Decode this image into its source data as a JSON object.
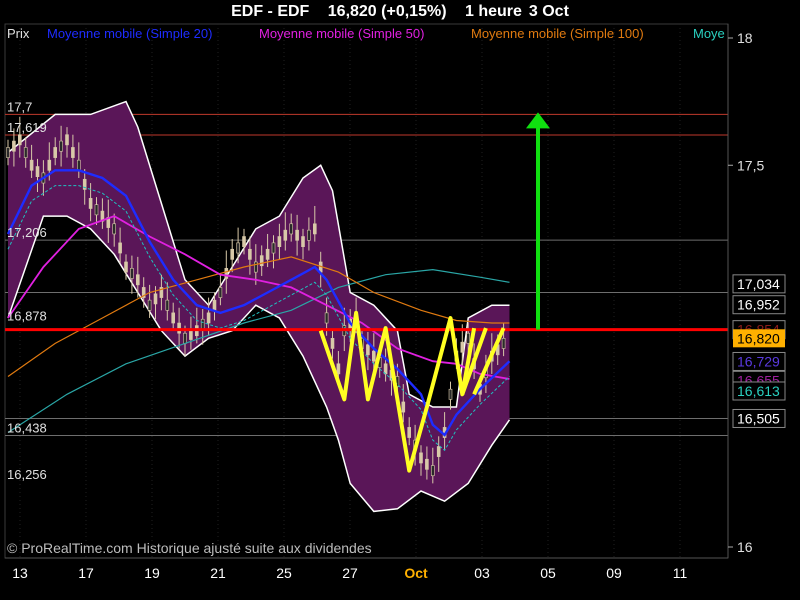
{
  "header": {
    "symbol": "EDF - EDF",
    "price": "16,820 (+0,15%)",
    "period": "1 heure",
    "date": "3 Oct"
  },
  "colors": {
    "background": "#000000",
    "grid": "#6e6e6e",
    "band_fill": "#5a1658",
    "band_line": "#ffffff",
    "sma20": "#1e2cff",
    "sma50": "#e020e0",
    "sma100": "#e07a10",
    "sma200": "#2aa6a6",
    "pattern": "#ffff22",
    "target": "#10e010",
    "resistance": "#ff0000",
    "hline": "#c0392b",
    "price_tag": "#ffb000"
  },
  "chart_data": {
    "type": "line",
    "title": "EDF - EDF",
    "y_axis": {
      "min": 16.0,
      "max": 18.0,
      "ticks": [
        "18",
        "17,5",
        "16"
      ],
      "position": "right"
    },
    "x_axis": {
      "ticks": [
        "13",
        "17",
        "19",
        "21",
        "25",
        "27",
        "Oct",
        "03",
        "05",
        "09",
        "11"
      ],
      "bold_tick": "Oct"
    },
    "legend": [
      "Prix",
      "Moyenne mobile (Simple 20)",
      "Moyenne mobile (Simple 50)",
      "Moyenne mobile (Simple 100)",
      "Moye"
    ],
    "watermark": "© ProRealTime.com Historique ajusté suite aux dividendes",
    "left_levels": [
      {
        "label": "17,7",
        "value": 17.7
      },
      {
        "label": "17,619",
        "value": 17.619
      },
      {
        "label": "17,206",
        "value": 17.206
      },
      {
        "label": "16,878",
        "value": 16.878
      },
      {
        "label": "16,438",
        "value": 16.438
      },
      {
        "label": "16,256",
        "value": 16.256
      }
    ],
    "horizontal_lines": [
      {
        "value": 17.7,
        "style": "red"
      },
      {
        "value": 17.619,
        "style": "red"
      },
      {
        "value": 17.206,
        "style": "gray"
      },
      {
        "value": 17.0,
        "style": "gray"
      },
      {
        "value": 16.505,
        "style": "gray"
      },
      {
        "value": 16.438,
        "style": "gray"
      }
    ],
    "resistance": 16.854,
    "target_arrow": {
      "from": 16.854,
      "to": 17.7,
      "x_index": 90
    },
    "right_tags": [
      {
        "label": "17,034",
        "value": 17.034,
        "color": "#000000",
        "text": "#ffffff"
      },
      {
        "label": "16,952",
        "value": 16.952,
        "color": "#000000",
        "text": "#ffffff"
      },
      {
        "label": "16,854",
        "value": 16.854,
        "color": "#000000",
        "text": "#8a1c1c"
      },
      {
        "label": "16,820",
        "value": 16.82,
        "color": "#ffb000",
        "text": "#000000"
      },
      {
        "label": "16,729",
        "value": 16.729,
        "color": "#000000",
        "text": "#5a3ae0"
      },
      {
        "label": "16,655",
        "value": 16.655,
        "color": "#000000",
        "text": "#a020a0"
      },
      {
        "label": "16,613",
        "value": 16.613,
        "color": "#000000",
        "text": "#2ad0c0"
      },
      {
        "label": "16,505",
        "value": 16.505,
        "color": "#000000",
        "text": "#ffffff"
      }
    ],
    "bollinger_upper": [
      [
        0,
        17.55
      ],
      [
        8,
        17.7
      ],
      [
        14,
        17.7
      ],
      [
        20,
        17.75
      ],
      [
        22,
        17.65
      ],
      [
        26,
        17.35
      ],
      [
        30,
        17.05
      ],
      [
        34,
        16.95
      ],
      [
        38,
        17.1
      ],
      [
        42,
        17.25
      ],
      [
        46,
        17.3
      ],
      [
        50,
        17.45
      ],
      [
        53,
        17.5
      ],
      [
        55,
        17.4
      ],
      [
        58,
        17.0
      ],
      [
        62,
        16.95
      ],
      [
        66,
        16.85
      ],
      [
        68,
        16.6
      ],
      [
        72,
        16.55
      ],
      [
        76,
        16.55
      ],
      [
        78,
        16.9
      ],
      [
        82,
        16.95
      ],
      [
        85,
        16.95
      ]
    ],
    "bollinger_lower": [
      [
        0,
        16.9
      ],
      [
        6,
        17.3
      ],
      [
        10,
        17.3
      ],
      [
        14,
        17.25
      ],
      [
        18,
        17.15
      ],
      [
        22,
        17.0
      ],
      [
        26,
        16.85
      ],
      [
        30,
        16.75
      ],
      [
        34,
        16.82
      ],
      [
        38,
        16.85
      ],
      [
        42,
        16.95
      ],
      [
        46,
        16.9
      ],
      [
        50,
        16.75
      ],
      [
        54,
        16.55
      ],
      [
        56,
        16.42
      ],
      [
        58,
        16.25
      ],
      [
        62,
        16.14
      ],
      [
        66,
        16.15
      ],
      [
        70,
        16.22
      ],
      [
        74,
        16.18
      ],
      [
        78,
        16.25
      ],
      [
        82,
        16.4
      ],
      [
        85,
        16.5
      ]
    ],
    "sma20": [
      [
        0,
        17.23
      ],
      [
        4,
        17.42
      ],
      [
        8,
        17.48
      ],
      [
        12,
        17.48
      ],
      [
        16,
        17.45
      ],
      [
        20,
        17.38
      ],
      [
        24,
        17.2
      ],
      [
        28,
        17.05
      ],
      [
        32,
        16.95
      ],
      [
        36,
        16.92
      ],
      [
        40,
        16.95
      ],
      [
        44,
        17.0
      ],
      [
        48,
        17.05
      ],
      [
        52,
        17.1
      ],
      [
        54,
        17.05
      ],
      [
        58,
        16.88
      ],
      [
        62,
        16.78
      ],
      [
        66,
        16.7
      ],
      [
        70,
        16.6
      ],
      [
        72,
        16.48
      ],
      [
        74,
        16.44
      ],
      [
        76,
        16.52
      ],
      [
        80,
        16.62
      ],
      [
        85,
        16.73
      ]
    ],
    "sma50": [
      [
        0,
        16.9
      ],
      [
        6,
        17.1
      ],
      [
        12,
        17.25
      ],
      [
        18,
        17.3
      ],
      [
        24,
        17.22
      ],
      [
        30,
        17.15
      ],
      [
        36,
        17.07
      ],
      [
        42,
        17.05
      ],
      [
        48,
        17.02
      ],
      [
        54,
        16.95
      ],
      [
        60,
        16.88
      ],
      [
        66,
        16.78
      ],
      [
        72,
        16.73
      ],
      [
        76,
        16.72
      ],
      [
        80,
        16.68
      ],
      [
        85,
        16.66
      ]
    ],
    "sma100": [
      [
        0,
        16.67
      ],
      [
        8,
        16.8
      ],
      [
        16,
        16.9
      ],
      [
        24,
        17.0
      ],
      [
        32,
        17.05
      ],
      [
        40,
        17.1
      ],
      [
        48,
        17.14
      ],
      [
        56,
        17.08
      ],
      [
        62,
        17.0
      ],
      [
        70,
        16.93
      ],
      [
        76,
        16.89
      ],
      [
        82,
        16.88
      ],
      [
        85,
        16.88
      ]
    ],
    "sma200": [
      [
        0,
        16.45
      ],
      [
        10,
        16.6
      ],
      [
        20,
        16.72
      ],
      [
        30,
        16.8
      ],
      [
        40,
        16.88
      ],
      [
        48,
        16.93
      ],
      [
        56,
        17.02
      ],
      [
        64,
        17.07
      ],
      [
        72,
        17.09
      ],
      [
        80,
        17.06
      ],
      [
        85,
        17.04
      ]
    ],
    "price": [
      [
        0,
        17.55
      ],
      [
        2,
        17.6
      ],
      [
        4,
        17.5
      ],
      [
        6,
        17.45
      ],
      [
        8,
        17.55
      ],
      [
        10,
        17.6
      ],
      [
        12,
        17.5
      ],
      [
        14,
        17.35
      ],
      [
        16,
        17.3
      ],
      [
        18,
        17.25
      ],
      [
        20,
        17.1
      ],
      [
        22,
        17.05
      ],
      [
        24,
        16.95
      ],
      [
        26,
        17.0
      ],
      [
        28,
        16.9
      ],
      [
        30,
        16.82
      ],
      [
        32,
        16.85
      ],
      [
        34,
        16.9
      ],
      [
        36,
        17.0
      ],
      [
        38,
        17.15
      ],
      [
        40,
        17.2
      ],
      [
        42,
        17.1
      ],
      [
        44,
        17.15
      ],
      [
        46,
        17.2
      ],
      [
        48,
        17.25
      ],
      [
        50,
        17.2
      ],
      [
        52,
        17.25
      ],
      [
        53,
        17.1
      ],
      [
        54,
        16.9
      ],
      [
        56,
        16.7
      ],
      [
        57,
        16.85
      ],
      [
        59,
        16.9
      ],
      [
        60,
        16.8
      ],
      [
        62,
        16.75
      ],
      [
        64,
        16.7
      ],
      [
        66,
        16.65
      ],
      [
        68,
        16.45
      ],
      [
        70,
        16.35
      ],
      [
        72,
        16.3
      ],
      [
        74,
        16.45
      ],
      [
        76,
        16.75
      ],
      [
        78,
        16.82
      ],
      [
        80,
        16.62
      ],
      [
        82,
        16.75
      ],
      [
        84,
        16.8
      ],
      [
        85,
        16.82
      ]
    ],
    "pattern_lines": [
      [
        [
          53,
          16.85
        ],
        [
          57,
          16.58
        ],
        [
          59,
          16.92
        ],
        [
          61,
          16.58
        ],
        [
          64,
          16.86
        ],
        [
          68,
          16.3
        ],
        [
          71,
          16.55
        ],
        [
          75,
          16.9
        ],
        [
          77,
          16.6
        ],
        [
          79,
          16.86
        ]
      ],
      [
        [
          77,
          16.6
        ],
        [
          81,
          16.86
        ]
      ]
    ]
  }
}
